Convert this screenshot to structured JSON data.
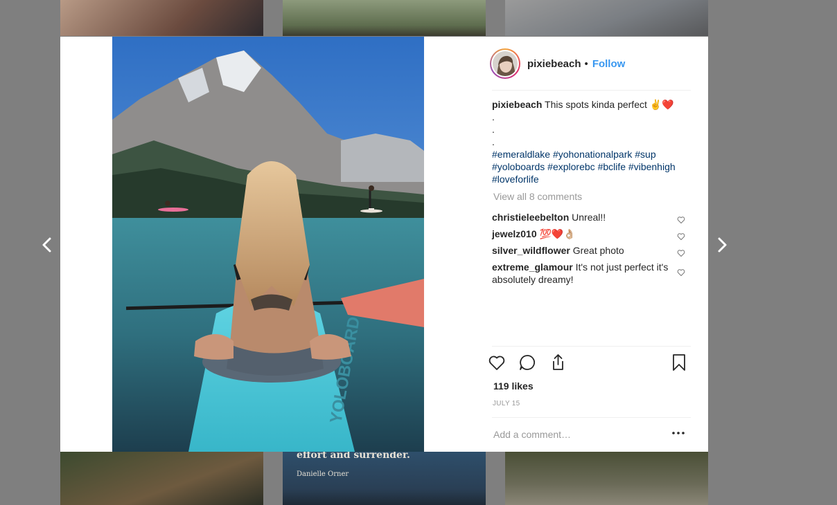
{
  "post": {
    "username": "pixiebeach",
    "header_separator": "•",
    "follow_label": "Follow",
    "caption_text": "This spots kinda perfect ✌️❤️",
    "caption_dots": [
      ".",
      ".",
      "."
    ],
    "hashtags": [
      "#emeraldlake",
      "#yohonationalpark",
      "#sup",
      "#yoloboards",
      "#explorebc",
      "#bclife",
      "#vibenhigh",
      "#loveforlife"
    ],
    "view_all_comments": "View all 8 comments",
    "likes": "119 likes",
    "date": "JULY 15",
    "add_comment_placeholder": "Add a comment…"
  },
  "comments": [
    {
      "user": "christieleebelton",
      "text": "Unreal!!"
    },
    {
      "user": "jewelz010",
      "text": "💯❤️👌🏼"
    },
    {
      "user": "silver_wildflower",
      "text": "Great photo"
    },
    {
      "user": "extreme_glamour",
      "text": "It's not just perfect it's absolutely dreamy!"
    }
  ],
  "background_tiles": {
    "quote_line": "effort and surrender.",
    "quote_author": "Danielle Orner"
  },
  "photo": {
    "board_text": "YOLOBOARD"
  },
  "icons": {
    "prev": "chevron-left-icon",
    "next": "chevron-right-icon",
    "like": "heart-icon",
    "comment": "comment-bubble-icon",
    "share": "share-icon",
    "save": "bookmark-icon",
    "more": "ellipsis-icon"
  },
  "colors": {
    "link_blue": "#3897f0",
    "hashtag": "#003569",
    "muted": "#999999",
    "text": "#262626",
    "backdrop": "#7f7f7f"
  }
}
